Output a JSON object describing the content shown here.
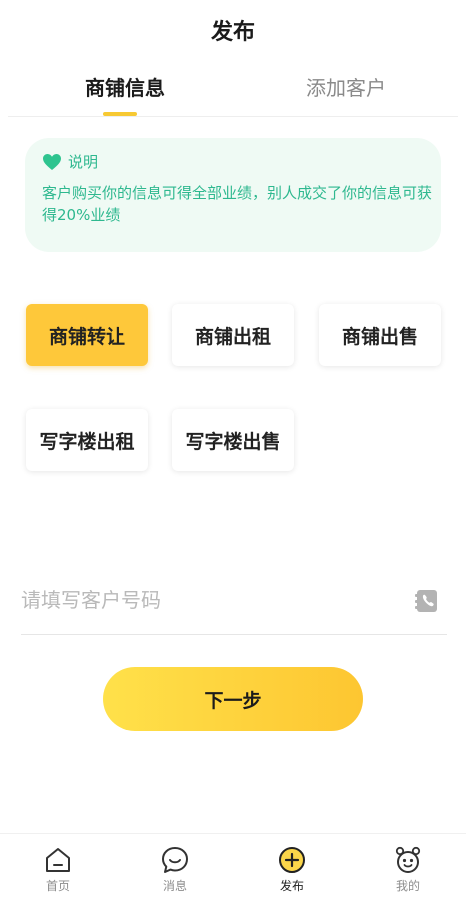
{
  "header": {
    "title": "发布"
  },
  "tabs": [
    {
      "label": "商铺信息",
      "active": true
    },
    {
      "label": "添加客户",
      "active": false
    }
  ],
  "notice": {
    "title": "说明",
    "text": "客户购买你的信息可得全部业绩，别人成交了你的信息可获得20%业绩",
    "icon": "heart-icon"
  },
  "categories": [
    {
      "label": "商铺转让",
      "selected": true
    },
    {
      "label": "商铺出租",
      "selected": false
    },
    {
      "label": "商铺出售",
      "selected": false
    },
    {
      "label": "写字楼出租",
      "selected": false
    },
    {
      "label": "写字楼出售",
      "selected": false
    }
  ],
  "phone": {
    "placeholder": "请填写客户号码",
    "value": "",
    "icon": "contacts-icon"
  },
  "next_button": {
    "label": "下一步"
  },
  "bottom_nav": [
    {
      "label": "首页",
      "icon": "home-icon",
      "active": false
    },
    {
      "label": "消息",
      "icon": "message-icon",
      "active": false
    },
    {
      "label": "发布",
      "icon": "add-circle-icon",
      "active": true
    },
    {
      "label": "我的",
      "icon": "profile-icon",
      "active": false
    }
  ],
  "colors": {
    "accent": "#fec83a",
    "notice_bg": "#effaf4",
    "notice_text": "#2eb88f",
    "tab_indicator": "#f7c933"
  }
}
